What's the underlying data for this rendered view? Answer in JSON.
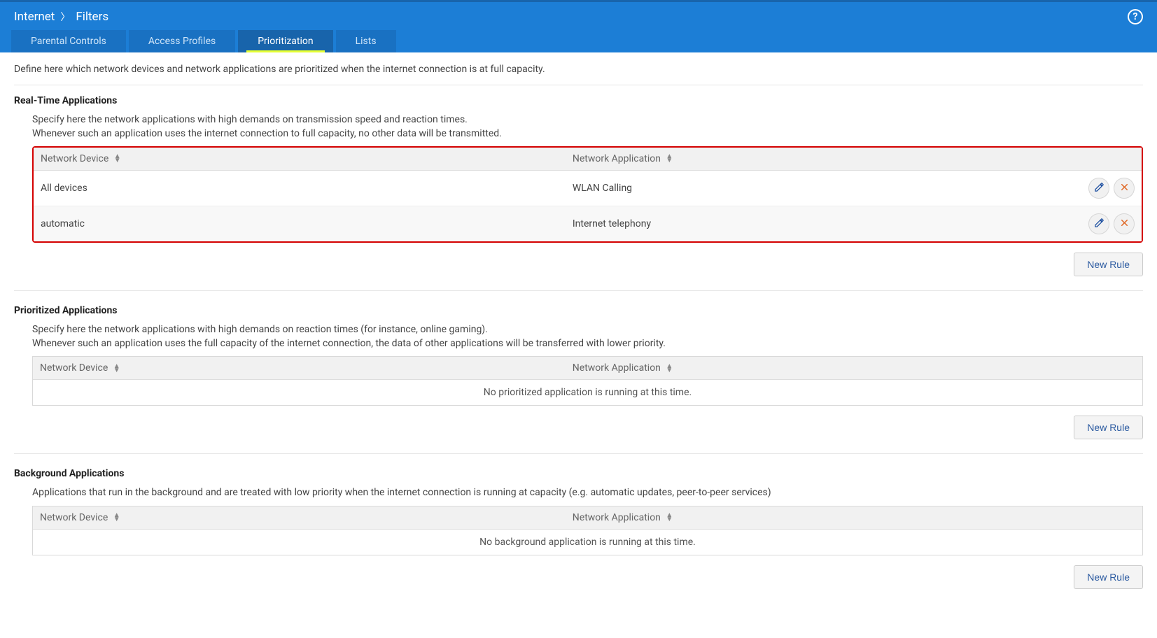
{
  "breadcrumb": {
    "a": "Internet",
    "b": "Filters"
  },
  "tabs": [
    {
      "label": "Parental Controls",
      "active": false
    },
    {
      "label": "Access Profiles",
      "active": false
    },
    {
      "label": "Prioritization",
      "active": true
    },
    {
      "label": "Lists",
      "active": false
    }
  ],
  "intro": "Define here which network devices and network applications are prioritized when the internet connection is at full capacity.",
  "columns": {
    "device": "Network Device",
    "app": "Network Application"
  },
  "new_rule_label": "New Rule",
  "sections": [
    {
      "key": "realtime",
      "title": "Real-Time Applications",
      "desc": "Specify here the network applications with high demands on transmission speed and reaction times.\nWhenever such an application uses the internet connection to full capacity, no other data will be transmitted.",
      "highlighted": true,
      "rows": [
        {
          "device": "All devices",
          "app": "WLAN Calling"
        },
        {
          "device": "automatic",
          "app": "Internet telephony"
        }
      ],
      "empty": null
    },
    {
      "key": "prioritized",
      "title": "Prioritized Applications",
      "desc": "Specify here the network applications with high demands on reaction times (for instance, online gaming).\nWhenever such an application uses the full capacity of the internet connection, the data of other applications will be transferred with lower priority.",
      "highlighted": false,
      "rows": [],
      "empty": "No prioritized application is running at this time."
    },
    {
      "key": "background",
      "title": "Background Applications",
      "desc": "Applications that run in the background and are treated with low priority when the internet connection is running at capacity (e.g. automatic updates, peer-to-peer services)",
      "highlighted": false,
      "rows": [],
      "empty": "No background application is running at this time."
    }
  ]
}
